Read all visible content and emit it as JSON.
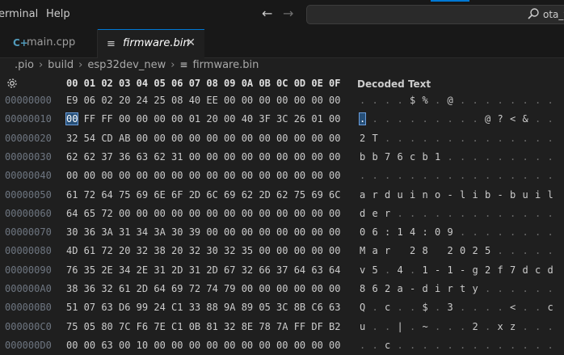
{
  "menu": {
    "items": [
      "erminal",
      "Help"
    ]
  },
  "search": {
    "text": "ota_v"
  },
  "tabs": [
    {
      "icon": "cpp-file-icon",
      "glyph": "C+",
      "label": "main.cpp",
      "active": false
    },
    {
      "icon": "binary-file-icon",
      "glyph": "≡",
      "label": "firmware.bin",
      "active": true
    }
  ],
  "breadcrumb": [
    ".pio",
    "build",
    "esp32dev_new",
    "firmware.bin"
  ],
  "hex": {
    "column_headers": [
      "00",
      "01",
      "02",
      "03",
      "04",
      "05",
      "06",
      "07",
      "08",
      "09",
      "0A",
      "0B",
      "0C",
      "0D",
      "0E",
      "0F"
    ],
    "decoded_title": "Decoded Text",
    "rows": [
      {
        "addr": "00000000",
        "bytes": [
          "E9",
          "06",
          "02",
          "20",
          "24",
          "25",
          "08",
          "40",
          "EE",
          "00",
          "00",
          "00",
          "00",
          "00",
          "00",
          "00"
        ],
        "decoded": [
          ".",
          ".",
          ".",
          ".",
          "$",
          "%",
          ".",
          "@",
          ".",
          ".",
          ".",
          ".",
          ".",
          ".",
          ".",
          "."
        ]
      },
      {
        "addr": "00000010",
        "bytes": [
          "00",
          "FF",
          "FF",
          "00",
          "00",
          "00",
          "00",
          "01",
          "20",
          "00",
          "40",
          "3F",
          "3C",
          "26",
          "01",
          "00"
        ],
        "decoded": [
          ".",
          ".",
          ".",
          ".",
          ".",
          ".",
          ".",
          ".",
          ".",
          ".",
          "@",
          "?",
          "<",
          "&",
          ".",
          "."
        ]
      },
      {
        "addr": "00000020",
        "bytes": [
          "32",
          "54",
          "CD",
          "AB",
          "00",
          "00",
          "00",
          "00",
          "00",
          "00",
          "00",
          "00",
          "00",
          "00",
          "00",
          "00"
        ],
        "decoded": [
          "2",
          "T",
          ".",
          ".",
          ".",
          ".",
          ".",
          ".",
          ".",
          ".",
          ".",
          ".",
          ".",
          ".",
          ".",
          "."
        ]
      },
      {
        "addr": "00000030",
        "bytes": [
          "62",
          "62",
          "37",
          "36",
          "63",
          "62",
          "31",
          "00",
          "00",
          "00",
          "00",
          "00",
          "00",
          "00",
          "00",
          "00"
        ],
        "decoded": [
          "b",
          "b",
          "7",
          "6",
          "c",
          "b",
          "1",
          ".",
          ".",
          ".",
          ".",
          ".",
          ".",
          ".",
          ".",
          "."
        ]
      },
      {
        "addr": "00000040",
        "bytes": [
          "00",
          "00",
          "00",
          "00",
          "00",
          "00",
          "00",
          "00",
          "00",
          "00",
          "00",
          "00",
          "00",
          "00",
          "00",
          "00"
        ],
        "decoded": [
          ".",
          ".",
          ".",
          ".",
          ".",
          ".",
          ".",
          ".",
          ".",
          ".",
          ".",
          ".",
          ".",
          ".",
          ".",
          "."
        ]
      },
      {
        "addr": "00000050",
        "bytes": [
          "61",
          "72",
          "64",
          "75",
          "69",
          "6E",
          "6F",
          "2D",
          "6C",
          "69",
          "62",
          "2D",
          "62",
          "75",
          "69",
          "6C"
        ],
        "decoded": [
          "a",
          "r",
          "d",
          "u",
          "i",
          "n",
          "o",
          "-",
          "l",
          "i",
          "b",
          "-",
          "b",
          "u",
          "i",
          "l"
        ]
      },
      {
        "addr": "00000060",
        "bytes": [
          "64",
          "65",
          "72",
          "00",
          "00",
          "00",
          "00",
          "00",
          "00",
          "00",
          "00",
          "00",
          "00",
          "00",
          "00",
          "00"
        ],
        "decoded": [
          "d",
          "e",
          "r",
          ".",
          ".",
          ".",
          ".",
          ".",
          ".",
          ".",
          ".",
          ".",
          ".",
          ".",
          ".",
          "."
        ]
      },
      {
        "addr": "00000070",
        "bytes": [
          "30",
          "36",
          "3A",
          "31",
          "34",
          "3A",
          "30",
          "39",
          "00",
          "00",
          "00",
          "00",
          "00",
          "00",
          "00",
          "00"
        ],
        "decoded": [
          "0",
          "6",
          ":",
          "1",
          "4",
          ":",
          "0",
          "9",
          ".",
          ".",
          ".",
          ".",
          ".",
          ".",
          ".",
          "."
        ]
      },
      {
        "addr": "00000080",
        "bytes": [
          "4D",
          "61",
          "72",
          "20",
          "32",
          "38",
          "20",
          "32",
          "30",
          "32",
          "35",
          "00",
          "00",
          "00",
          "00",
          "00"
        ],
        "decoded": [
          "M",
          "a",
          "r",
          " ",
          "2",
          "8",
          " ",
          "2",
          "0",
          "2",
          "5",
          ".",
          ".",
          ".",
          ".",
          "."
        ]
      },
      {
        "addr": "00000090",
        "bytes": [
          "76",
          "35",
          "2E",
          "34",
          "2E",
          "31",
          "2D",
          "31",
          "2D",
          "67",
          "32",
          "66",
          "37",
          "64",
          "63",
          "64"
        ],
        "decoded": [
          "v",
          "5",
          ".",
          "4",
          ".",
          "1",
          "-",
          "1",
          "-",
          "g",
          "2",
          "f",
          "7",
          "d",
          "c",
          "d"
        ]
      },
      {
        "addr": "000000A0",
        "bytes": [
          "38",
          "36",
          "32",
          "61",
          "2D",
          "64",
          "69",
          "72",
          "74",
          "79",
          "00",
          "00",
          "00",
          "00",
          "00",
          "00"
        ],
        "decoded": [
          "8",
          "6",
          "2",
          "a",
          "-",
          "d",
          "i",
          "r",
          "t",
          "y",
          ".",
          ".",
          ".",
          ".",
          ".",
          "."
        ]
      },
      {
        "addr": "000000B0",
        "bytes": [
          "51",
          "07",
          "63",
          "D6",
          "99",
          "24",
          "C1",
          "33",
          "88",
          "9A",
          "89",
          "05",
          "3C",
          "8B",
          "C6",
          "63"
        ],
        "decoded": [
          "Q",
          ".",
          "c",
          ".",
          ".",
          "$",
          ".",
          "3",
          ".",
          ".",
          ".",
          ".",
          "<",
          ".",
          ".",
          "c"
        ]
      },
      {
        "addr": "000000C0",
        "bytes": [
          "75",
          "05",
          "80",
          "7C",
          "F6",
          "7E",
          "C1",
          "0B",
          "81",
          "32",
          "8E",
          "78",
          "7A",
          "FF",
          "DF",
          "B2"
        ],
        "decoded": [
          "u",
          ".",
          ".",
          "|",
          ".",
          "~",
          ".",
          ".",
          ".",
          "2",
          ".",
          "x",
          "z",
          ".",
          ".",
          "."
        ]
      },
      {
        "addr": "000000D0",
        "bytes": [
          "00",
          "00",
          "63",
          "00",
          "10",
          "00",
          "00",
          "00",
          "00",
          "00",
          "00",
          "00",
          "00",
          "00",
          "00",
          "00"
        ],
        "decoded": [
          ".",
          ".",
          "c",
          ".",
          ".",
          ".",
          ".",
          ".",
          ".",
          ".",
          ".",
          ".",
          ".",
          ".",
          ".",
          "."
        ]
      }
    ]
  },
  "colors": {
    "accent": "#0078d4",
    "selection": "#264f78",
    "background": "#1f1f1f"
  },
  "selection": {
    "row": 1,
    "col": 0
  }
}
